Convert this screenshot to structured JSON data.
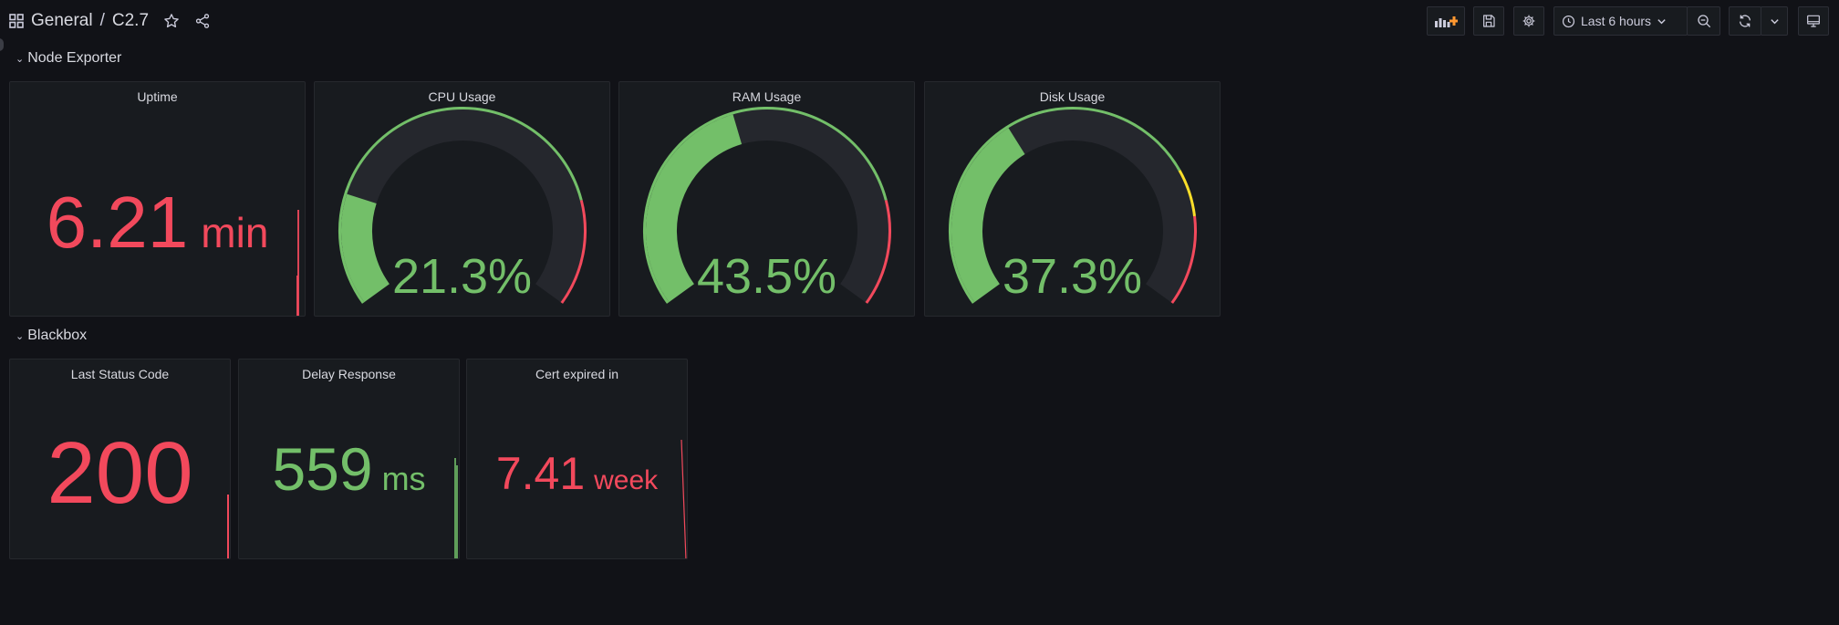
{
  "breadcrumb": {
    "folder": "General",
    "separator": "/",
    "dashboard": "C2.7"
  },
  "toolbar": {
    "time_range": "Last 6 hours"
  },
  "rows": [
    {
      "title": "Node Exporter"
    },
    {
      "title": "Blackbox"
    }
  ],
  "panels": {
    "uptime": {
      "title": "Uptime",
      "value": "6.21",
      "unit": "min"
    },
    "cpu": {
      "title": "CPU Usage",
      "value": "21.3%",
      "fraction": 0.213
    },
    "ram": {
      "title": "RAM Usage",
      "value": "43.5%",
      "fraction": 0.435
    },
    "disk": {
      "title": "Disk Usage",
      "value": "37.3%",
      "fraction": 0.373
    },
    "status": {
      "title": "Last Status Code",
      "value": "200"
    },
    "delay": {
      "title": "Delay Response",
      "value": "559",
      "unit": "ms"
    },
    "cert": {
      "title": "Cert expired in",
      "value": "7.41",
      "unit": "week"
    }
  },
  "colors": {
    "green": "#73bf69",
    "red": "#f2495c",
    "yellow": "#fade2a",
    "track": "#25272d",
    "background": "#111217",
    "panel": "#181b1f"
  }
}
